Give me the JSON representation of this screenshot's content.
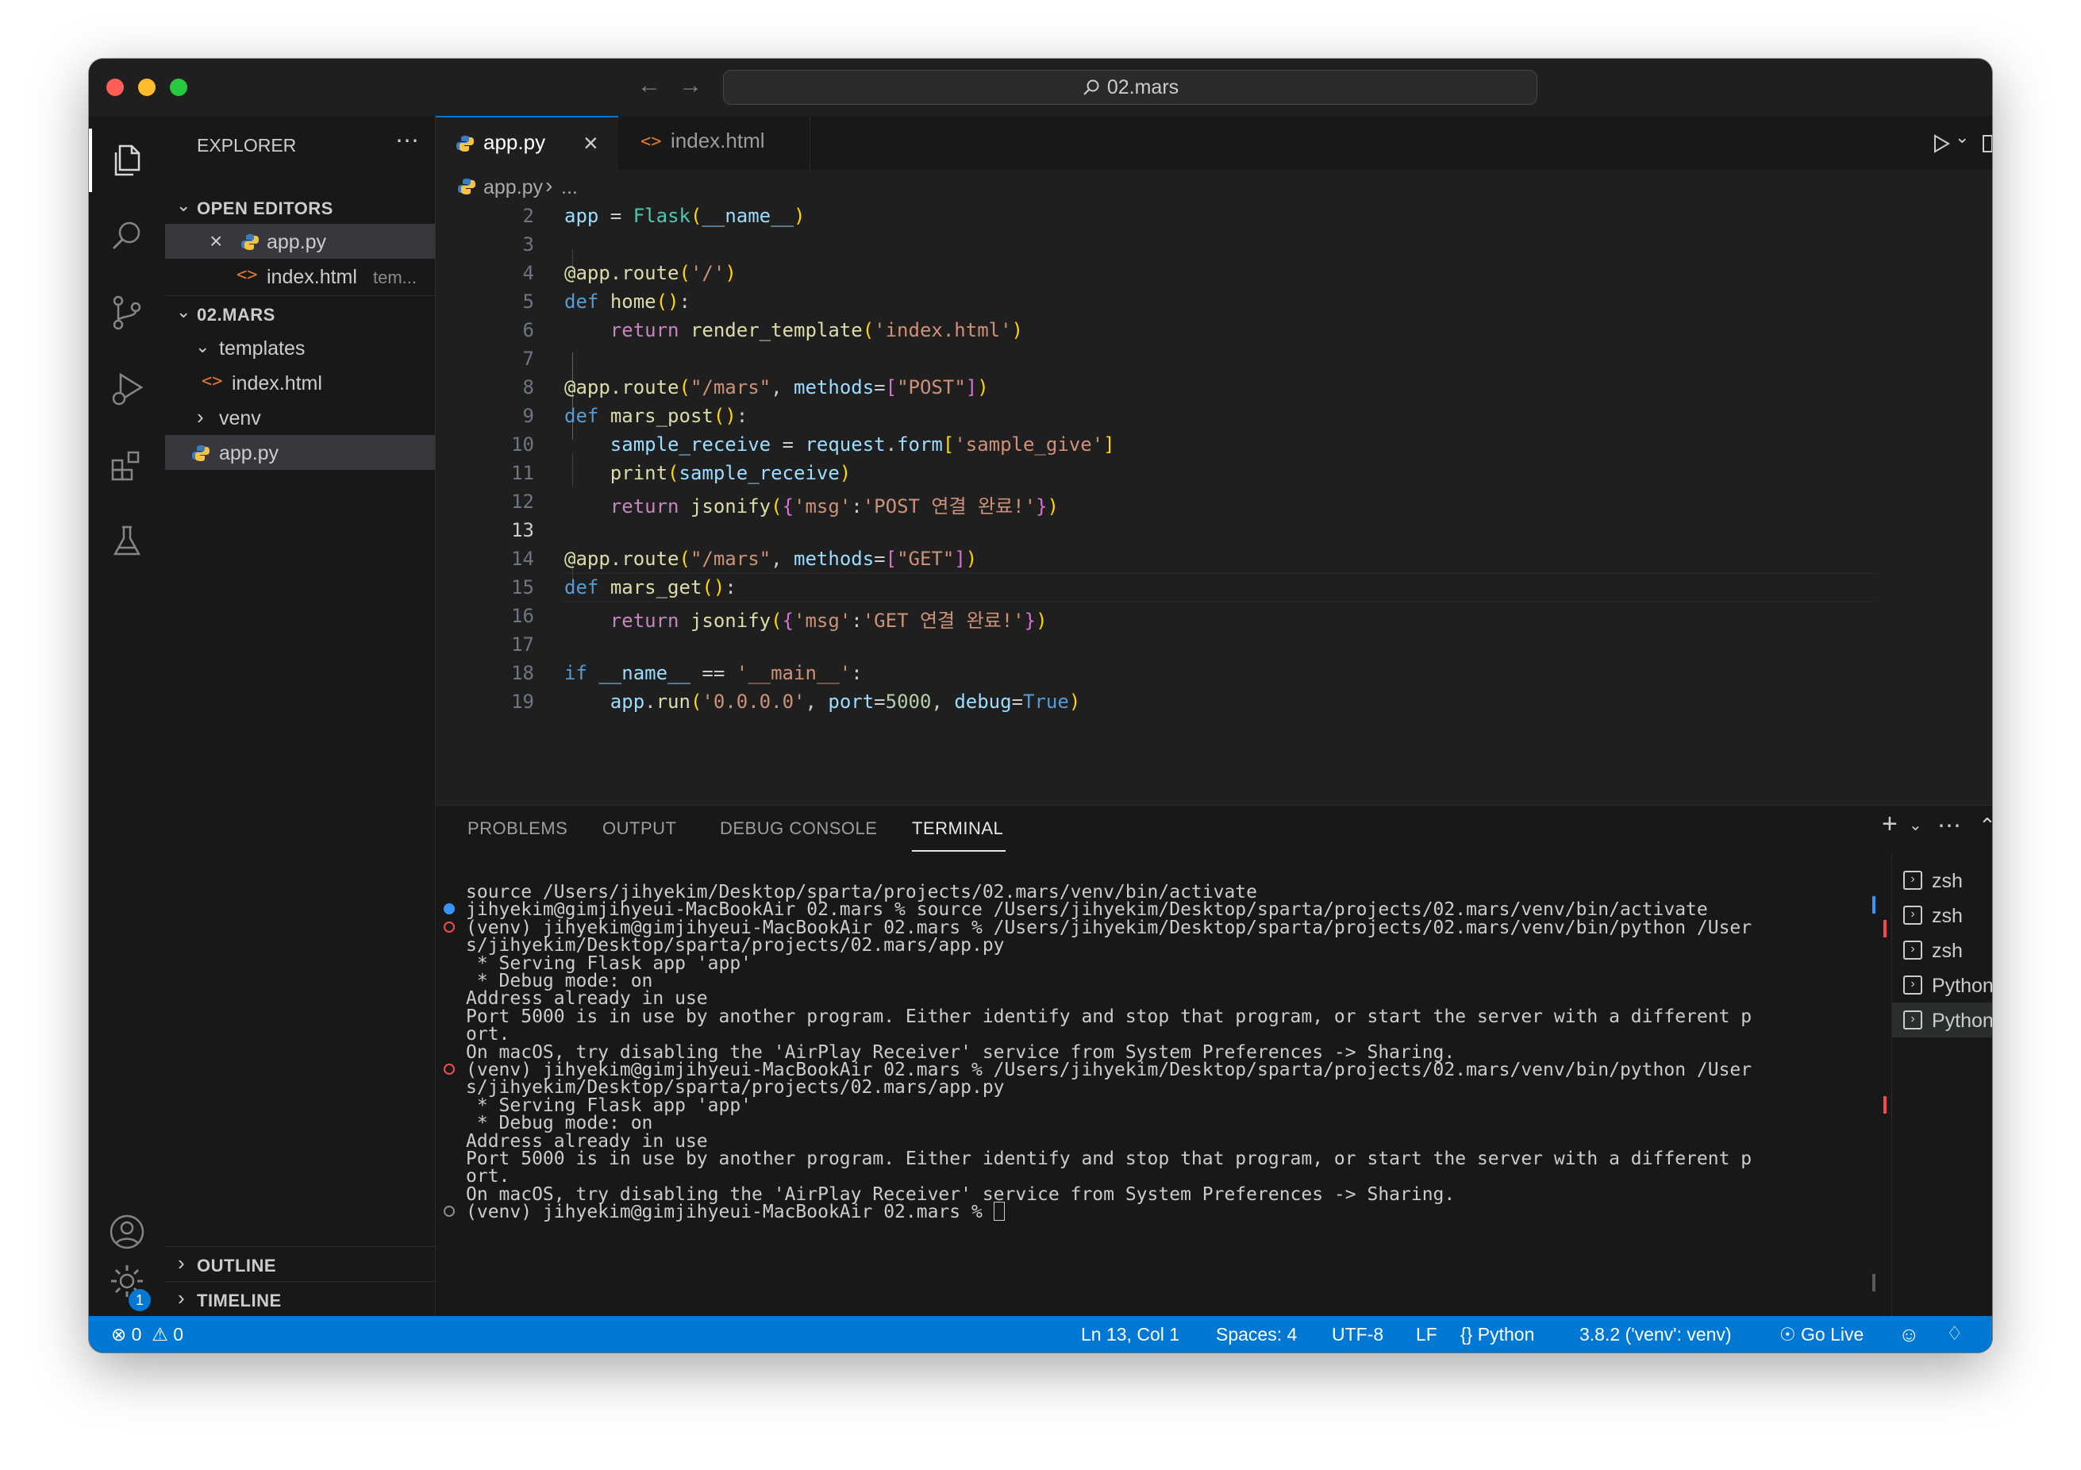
{
  "titlebar": {
    "search_text": "02.mars"
  },
  "sidebar": {
    "title": "EXPLORER",
    "open_editors": {
      "header": "OPEN EDITORS",
      "items": [
        {
          "name": "app.py",
          "desc": ""
        },
        {
          "name": "index.html",
          "desc": "tem..."
        }
      ]
    },
    "project": {
      "header": "02.MARS",
      "items": [
        "templates",
        "index.html",
        "venv",
        "app.py"
      ]
    },
    "outline": "OUTLINE",
    "timeline": "TIMELINE"
  },
  "tabs": [
    {
      "label": "app.py",
      "active": true
    },
    {
      "label": "index.html",
      "active": false
    }
  ],
  "breadcrumb": {
    "file": "app.py",
    "rest": "..."
  },
  "editor": {
    "current_line": 13,
    "lines": [
      {
        "n": "2",
        "text": "app = Flask(__name__)"
      },
      {
        "n": "3",
        "text": ""
      },
      {
        "n": "4",
        "text": "@app.route('/')"
      },
      {
        "n": "5",
        "text": "def home():"
      },
      {
        "n": "6",
        "text": "    return render_template('index.html')"
      },
      {
        "n": "7",
        "text": ""
      },
      {
        "n": "8",
        "text": "@app.route(\"/mars\", methods=[\"POST\"])"
      },
      {
        "n": "9",
        "text": "def mars_post():"
      },
      {
        "n": "10",
        "text": "    sample_receive = request.form['sample_give']"
      },
      {
        "n": "11",
        "text": "    print(sample_receive)"
      },
      {
        "n": "12",
        "text": "    return jsonify({'msg':'POST 연결 완료!'})"
      },
      {
        "n": "13",
        "text": ""
      },
      {
        "n": "14",
        "text": "@app.route(\"/mars\", methods=[\"GET\"])"
      },
      {
        "n": "15",
        "text": "def mars_get():"
      },
      {
        "n": "16",
        "text": "    return jsonify({'msg':'GET 연결 완료!'})"
      },
      {
        "n": "17",
        "text": ""
      },
      {
        "n": "18",
        "text": "if __name__ == '__main__':"
      },
      {
        "n": "19",
        "text": "    app.run('0.0.0.0', port=5000, debug=True)"
      }
    ]
  },
  "panel": {
    "tabs": [
      "PROBLEMS",
      "OUTPUT",
      "DEBUG CONSOLE",
      "TERMINAL"
    ],
    "active_tab": "TERMINAL",
    "terminal_lines": [
      {
        "text": "source /Users/jihyekim/Desktop/sparta/projects/02.mars/venv/bin/activate",
        "deco": ""
      },
      {
        "text": "jihyekim@gimjihyeui-MacBookAir 02.mars % source /Users/jihyekim/Desktop/sparta/projects/02.mars/venv/bin/activate",
        "deco": "ok"
      },
      {
        "text": "(venv) jihyekim@gimjihyeui-MacBookAir 02.mars % /Users/jihyekim/Desktop/sparta/projects/02.mars/venv/bin/python /User",
        "deco": "err"
      },
      {
        "text": "s/jihyekim/Desktop/sparta/projects/02.mars/app.py",
        "deco": ""
      },
      {
        "text": " * Serving Flask app 'app'",
        "deco": ""
      },
      {
        "text": " * Debug mode: on",
        "deco": ""
      },
      {
        "text": "Address already in use",
        "deco": ""
      },
      {
        "text": "Port 5000 is in use by another program. Either identify and stop that program, or start the server with a different p",
        "deco": ""
      },
      {
        "text": "ort.",
        "deco": ""
      },
      {
        "text": "On macOS, try disabling the 'AirPlay Receiver' service from System Preferences -> Sharing.",
        "deco": ""
      },
      {
        "text": "(venv) jihyekim@gimjihyeui-MacBookAir 02.mars % /Users/jihyekim/Desktop/sparta/projects/02.mars/venv/bin/python /User",
        "deco": "err"
      },
      {
        "text": "s/jihyekim/Desktop/sparta/projects/02.mars/app.py",
        "deco": ""
      },
      {
        "text": " * Serving Flask app 'app'",
        "deco": ""
      },
      {
        "text": " * Debug mode: on",
        "deco": ""
      },
      {
        "text": "Address already in use",
        "deco": ""
      },
      {
        "text": "Port 5000 is in use by another program. Either identify and stop that program, or start the server with a different p",
        "deco": ""
      },
      {
        "text": "ort.",
        "deco": ""
      },
      {
        "text": "On macOS, try disabling the 'AirPlay Receiver' service from System Preferences -> Sharing.",
        "deco": ""
      },
      {
        "text": "(venv) jihyekim@gimjihyeui-MacBookAir 02.mars % ",
        "deco": "idle"
      }
    ],
    "terminals": [
      "zsh",
      "zsh",
      "zsh",
      "Python",
      "Python"
    ],
    "selected_terminal": 4
  },
  "statusbar": {
    "errors": "0",
    "warnings": "0",
    "position": "Ln 13, Col 1",
    "spaces": "Spaces: 4",
    "encoding": "UTF-8",
    "eol": "LF",
    "language": "Python",
    "interpreter": "3.8.2 ('venv': venv)",
    "golive": "Go Live",
    "notifications_badge": "1"
  },
  "colors": {
    "accent": "#0078d4",
    "traffic_close": "#ff5f57",
    "traffic_min": "#febc2e",
    "traffic_max": "#28c840",
    "terminal_ok": "#3794ff",
    "terminal_err": "#f14c4c"
  }
}
